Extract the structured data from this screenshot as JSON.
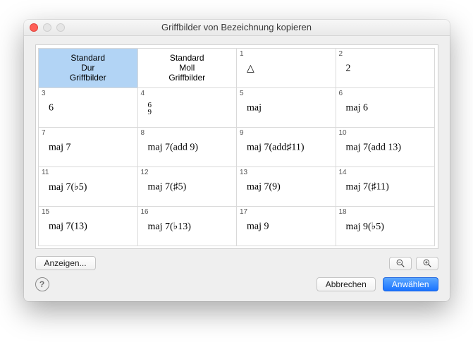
{
  "window": {
    "title": "Griffbilder von Bezeichnung kopieren"
  },
  "grid": {
    "cells": [
      {
        "num": "",
        "label": "Standard\nDur\nGriffbilder",
        "center": true,
        "selected": true
      },
      {
        "num": "",
        "label": "Standard\nMoll\nGriffbilder",
        "center": true
      },
      {
        "num": "1",
        "label": "△"
      },
      {
        "num": "2",
        "label": "2"
      },
      {
        "num": "3",
        "label": "6"
      },
      {
        "num": "4",
        "label": "6\n9",
        "stack": true
      },
      {
        "num": "5",
        "label": "maj"
      },
      {
        "num": "6",
        "label": "maj 6"
      },
      {
        "num": "7",
        "label": "maj 7"
      },
      {
        "num": "8",
        "label": "maj 7(add 9)"
      },
      {
        "num": "9",
        "label": "maj 7(add♯11)"
      },
      {
        "num": "10",
        "label": "maj 7(add 13)"
      },
      {
        "num": "11",
        "label": "maj 7(♭5)"
      },
      {
        "num": "12",
        "label": "maj 7(♯5)"
      },
      {
        "num": "13",
        "label": "maj 7(9)"
      },
      {
        "num": "14",
        "label": "maj 7(♯11)"
      },
      {
        "num": "15",
        "label": "maj 7(13)"
      },
      {
        "num": "16",
        "label": "maj 7(♭13)"
      },
      {
        "num": "17",
        "label": "maj 9"
      },
      {
        "num": "18",
        "label": "maj 9(♭5)"
      }
    ]
  },
  "controls": {
    "show_label": "Anzeigen...",
    "zoom_out_title": "Zoom Out",
    "zoom_in_title": "Zoom In"
  },
  "footer": {
    "help_char": "?",
    "cancel_label": "Abbrechen",
    "select_label": "Anwählen"
  }
}
